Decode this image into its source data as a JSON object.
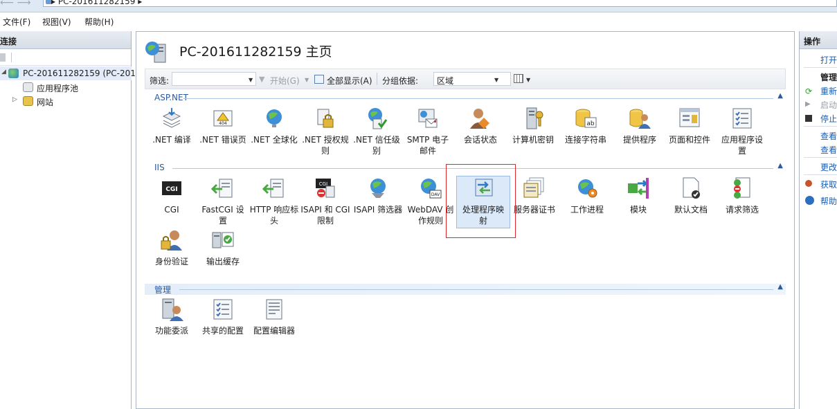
{
  "address_bar": {
    "crumb": "PC-201611282159"
  },
  "menu": {
    "file": "文件(F)",
    "view": "视图(V)",
    "help": "帮助(H)"
  },
  "left_pane": {
    "header": "连接",
    "tree": [
      {
        "label": "PC-201611282159 (PC-201"
      },
      {
        "label": "应用程序池"
      },
      {
        "label": "网站"
      }
    ]
  },
  "center": {
    "title": "PC-201611282159 主页",
    "toolbar": {
      "filter_label": "筛选:",
      "start": "开始(G)",
      "show_all": "全部显示(A)",
      "group_by_label": "分组依据:",
      "group_by_value": "区域"
    },
    "sections": {
      "aspnet": "ASP.NET",
      "iis": "IIS",
      "manage": "管理"
    },
    "aspnet_features": [
      {
        "l1": ".NET 编译",
        "l2": ""
      },
      {
        "l1": ".NET 错误页",
        "l2": ""
      },
      {
        "l1": ".NET 全球化",
        "l2": ""
      },
      {
        "l1": ".NET 授权规",
        "l2": "则"
      },
      {
        "l1": ".NET 信任级",
        "l2": "别"
      },
      {
        "l1": "SMTP 电子",
        "l2": "邮件"
      },
      {
        "l1": "会话状态",
        "l2": ""
      },
      {
        "l1": "计算机密钥",
        "l2": ""
      },
      {
        "l1": "连接字符串",
        "l2": ""
      },
      {
        "l1": "提供程序",
        "l2": ""
      },
      {
        "l1": "页面和控件",
        "l2": ""
      },
      {
        "l1": "应用程序设",
        "l2": "置"
      }
    ],
    "iis_features": [
      {
        "l1": "CGI",
        "l2": ""
      },
      {
        "l1": "FastCGI 设",
        "l2": "置"
      },
      {
        "l1": "HTTP 响应标",
        "l2": "头"
      },
      {
        "l1": "ISAPI 和 CGI",
        "l2": "限制"
      },
      {
        "l1": "ISAPI 筛选器",
        "l2": ""
      },
      {
        "l1": "WebDAV 创",
        "l2": "作规则"
      },
      {
        "l1": "处理程序映",
        "l2": "射"
      },
      {
        "l1": "服务器证书",
        "l2": ""
      },
      {
        "l1": "工作进程",
        "l2": ""
      },
      {
        "l1": "模块",
        "l2": ""
      },
      {
        "l1": "默认文档",
        "l2": ""
      },
      {
        "l1": "请求筛选",
        "l2": ""
      },
      {
        "l1": "身份验证",
        "l2": ""
      },
      {
        "l1": "输出缓存",
        "l2": ""
      }
    ],
    "manage_features": [
      {
        "l1": "功能委派",
        "l2": ""
      },
      {
        "l1": "共享的配置",
        "l2": ""
      },
      {
        "l1": "配置编辑器",
        "l2": ""
      }
    ],
    "icon_texts": {
      "cgi": "CGI",
      "err": "404",
      "cgi_small": "CGI",
      "dav": "DAV",
      "ab": "ab"
    }
  },
  "right_pane": {
    "header": "操作",
    "items": {
      "open": "打开",
      "manage": "管理",
      "restart": "重新",
      "start": "启动",
      "stop": "停止",
      "view1": "查看",
      "view2": "查看",
      "change": "更改",
      "get": "获取",
      "help": "帮助"
    }
  },
  "colors": {
    "accent": "#2c5aa0",
    "highlight_box": "#e0242b",
    "selection": "#dbe9f8"
  }
}
